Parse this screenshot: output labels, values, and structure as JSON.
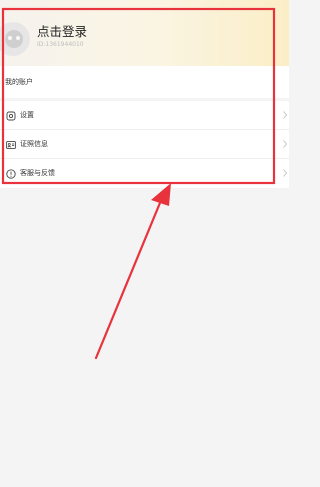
{
  "profile": {
    "login_prompt": "点击登录",
    "user_id": "ID:1361944010"
  },
  "account_section": {
    "title": "我的账户"
  },
  "menu": {
    "items": [
      {
        "label": "设置",
        "icon": "gear-icon"
      },
      {
        "label": "证照信息",
        "icon": "id-card-icon"
      },
      {
        "label": "客服与反馈",
        "icon": "info-icon"
      }
    ]
  },
  "annotation": {
    "color": "#e8323c",
    "box": "highlight-rectangle",
    "arrow": "pointer-arrow"
  }
}
